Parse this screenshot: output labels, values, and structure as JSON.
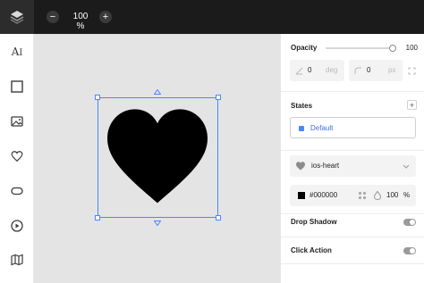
{
  "toolbar": {
    "zoom_out": "−",
    "zoom_level": "100 %",
    "zoom_in": "+"
  },
  "sidebar": {
    "text_label": "A",
    "tools": [
      "text-tool",
      "rectangle-tool",
      "image-tool",
      "icon-tool",
      "button-tool",
      "video-tool",
      "map-tool"
    ]
  },
  "canvas": {
    "shape": "ios-heart",
    "fill": "#000000"
  },
  "panel": {
    "opacity": {
      "label": "Opacity",
      "value": "100",
      "level": 1.0
    },
    "rotation": {
      "value": "0",
      "unit": "deg"
    },
    "radius": {
      "value": "0",
      "unit": "px"
    },
    "states": {
      "label": "States",
      "add": "+",
      "default": "Default"
    },
    "icon": {
      "name": "ios-heart"
    },
    "color": {
      "hex": "#000000",
      "opacity": "100",
      "unit": "%"
    },
    "drop_shadow": {
      "label": "Drop Shadow",
      "on": false
    },
    "click_action": {
      "label": "Click Action",
      "on": false
    }
  },
  "colors": {
    "accent": "#4a86ff",
    "topbar": "#1b1b1b",
    "canvas_bg": "#e4e4e4"
  }
}
